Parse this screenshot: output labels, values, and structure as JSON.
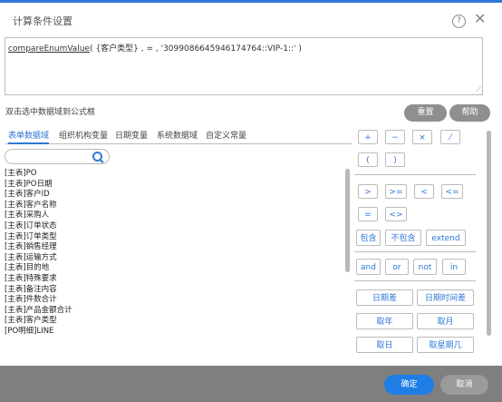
{
  "dialog": {
    "title": "计算条件设置",
    "help_glyph": "?",
    "close_glyph": "✕"
  },
  "formula": {
    "fn_name": "compareEnumValue",
    "rest": "( {客户类型} , = , '3099086645946174764::VIP-1::' )"
  },
  "hint": "双击选中数据域到公式框",
  "actions": {
    "reset": "重置",
    "help": "帮助"
  },
  "tabs": [
    {
      "label": "表单数据域"
    },
    {
      "label": "组织机构变量"
    },
    {
      "label": "日期变量"
    },
    {
      "label": "系统数据域"
    },
    {
      "label": "自定义常量"
    }
  ],
  "search": {
    "placeholder": ""
  },
  "fields": [
    "[主表]PO",
    "[主表]PO日期",
    "[主表]客户ID",
    "[主表]客户名称",
    "[主表]采购人",
    "[主表]订单状态",
    "[主表]订单类型",
    "[主表]销售经理",
    "[主表]运输方式",
    "[主表]目的地",
    "[主表]特殊要求",
    "[主表]备注内容",
    "[主表]件数合计",
    "[主表]产品金额合计",
    "[主表]客户类型",
    "[PO明细]LINE"
  ],
  "operators": {
    "arith": [
      "+",
      "−",
      "×",
      "⁄"
    ],
    "parens": [
      "(",
      ")"
    ],
    "compare": [
      ">",
      ">=",
      "<",
      "<="
    ],
    "equal": [
      "=",
      "<>"
    ],
    "contain": [
      "包含",
      "不包含",
      "extend"
    ],
    "logic": [
      "and",
      "or",
      "not",
      "in"
    ],
    "date": [
      "日期差",
      "日期时间差",
      "取年",
      "取月",
      "取日",
      "取星期几"
    ]
  },
  "footer": {
    "ok": "确定",
    "cancel": "取消"
  }
}
